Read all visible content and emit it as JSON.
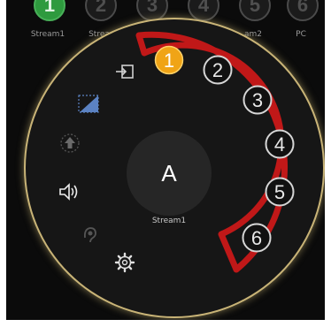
{
  "top_bar": {
    "items": [
      {
        "number": "1",
        "label": "Stream1",
        "active": true
      },
      {
        "number": "2",
        "label": "Strea",
        "active": false
      },
      {
        "number": "3",
        "label": "",
        "active": false
      },
      {
        "number": "4",
        "label": "",
        "active": false
      },
      {
        "number": "5",
        "label": "am2",
        "active": false
      },
      {
        "number": "6",
        "label": "PC",
        "active": false
      }
    ]
  },
  "wheel": {
    "center_letter": "A",
    "center_label": "Stream1",
    "selectors": [
      {
        "number": "1",
        "active": true
      },
      {
        "number": "2",
        "active": false
      },
      {
        "number": "3",
        "active": false
      },
      {
        "number": "4",
        "active": false
      },
      {
        "number": "5",
        "active": false
      },
      {
        "number": "6",
        "active": false
      }
    ],
    "side_icons": [
      "input-switch-icon",
      "aspect-ratio-icon",
      "upload-icon",
      "speaker-icon",
      "listen-icon",
      "settings-gear-icon"
    ]
  },
  "colors": {
    "active_top": "#2e9a3e",
    "active_selector": "#f0a416",
    "highlight": "#c01818",
    "ring_glow": "#c9b477"
  }
}
